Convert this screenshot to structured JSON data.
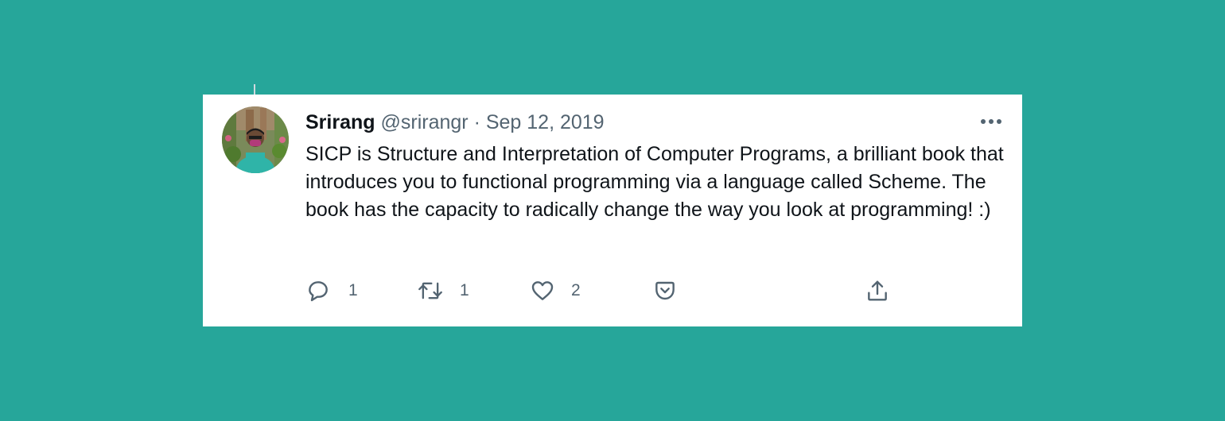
{
  "tweet": {
    "author_name": "Srirang",
    "handle": "@srirangr",
    "separator": "·",
    "date": "Sep 12, 2019",
    "text": "SICP is Structure and Interpretation of Computer Programs, a brilliant book that introduces you to functional programming via a language called Scheme. The book has the capacity to radically change the way you look at programming! :)"
  },
  "actions": {
    "reply_count": "1",
    "retweet_count": "1",
    "like_count": "2"
  },
  "colors": {
    "background": "#26a69a",
    "card": "#ffffff",
    "text_primary": "#0f1419",
    "text_secondary": "#536471"
  },
  "icons": {
    "more": "more-dots-icon",
    "reply": "reply-icon",
    "retweet": "retweet-icon",
    "like": "heart-icon",
    "pocket": "pocket-icon",
    "share": "share-icon"
  }
}
